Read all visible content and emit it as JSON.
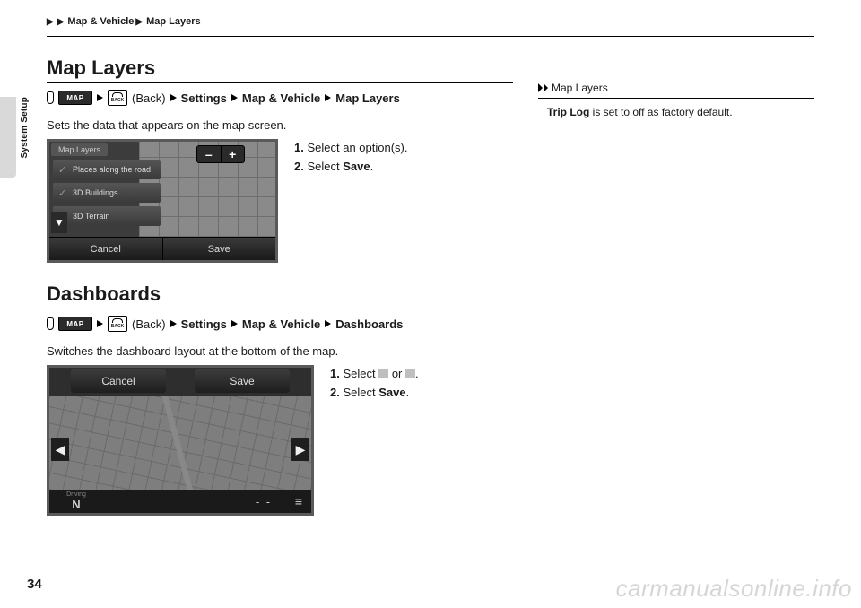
{
  "breadcrumb": {
    "a": "Map & Vehicle",
    "b": "Map Layers"
  },
  "side_label": "System Setup",
  "section1": {
    "title": "Map Layers",
    "nav": {
      "map_btn": "MAP",
      "back_label": "BACK",
      "back_text": "(Back)",
      "p1": "Settings",
      "p2": "Map & Vehicle",
      "p3": "Map Layers"
    },
    "desc": "Sets the data that appears on the map screen.",
    "screenshot": {
      "tab": "Map Layers",
      "item1": "Places along the road",
      "item2": "3D Buildings",
      "item3": "3D Terrain",
      "minus": "–",
      "plus": "+",
      "arrow_down": "▼",
      "cancel": "Cancel",
      "save": "Save"
    },
    "steps": {
      "n1": "1.",
      "s1": "Select an option(s).",
      "n2": "2.",
      "s2a": "Select ",
      "s2b": "Save",
      "s2c": "."
    }
  },
  "section2": {
    "title": "Dashboards",
    "nav": {
      "map_btn": "MAP",
      "back_label": "BACK",
      "back_text": "(Back)",
      "p1": "Settings",
      "p2": "Map & Vehicle",
      "p3": "Dashboards"
    },
    "desc": "Switches the dashboard layout at the bottom of the map.",
    "screenshot": {
      "cancel": "Cancel",
      "save": "Save",
      "left": "◀",
      "right": "▶",
      "drv_label": "Driving",
      "drv_val": "N",
      "dash": "- -",
      "menu": "≡"
    },
    "steps": {
      "n1": "1.",
      "s1a": "Select ",
      "s1b": " or ",
      "s1c": ".",
      "n2": "2.",
      "s2a": "Select ",
      "s2b": "Save",
      "s2c": "."
    }
  },
  "sidebar": {
    "title": "Map Layers",
    "body_b": "Trip Log",
    "body_rest": " is set to off as factory default."
  },
  "page_num": "34",
  "watermark": "carmanualsonline.info"
}
